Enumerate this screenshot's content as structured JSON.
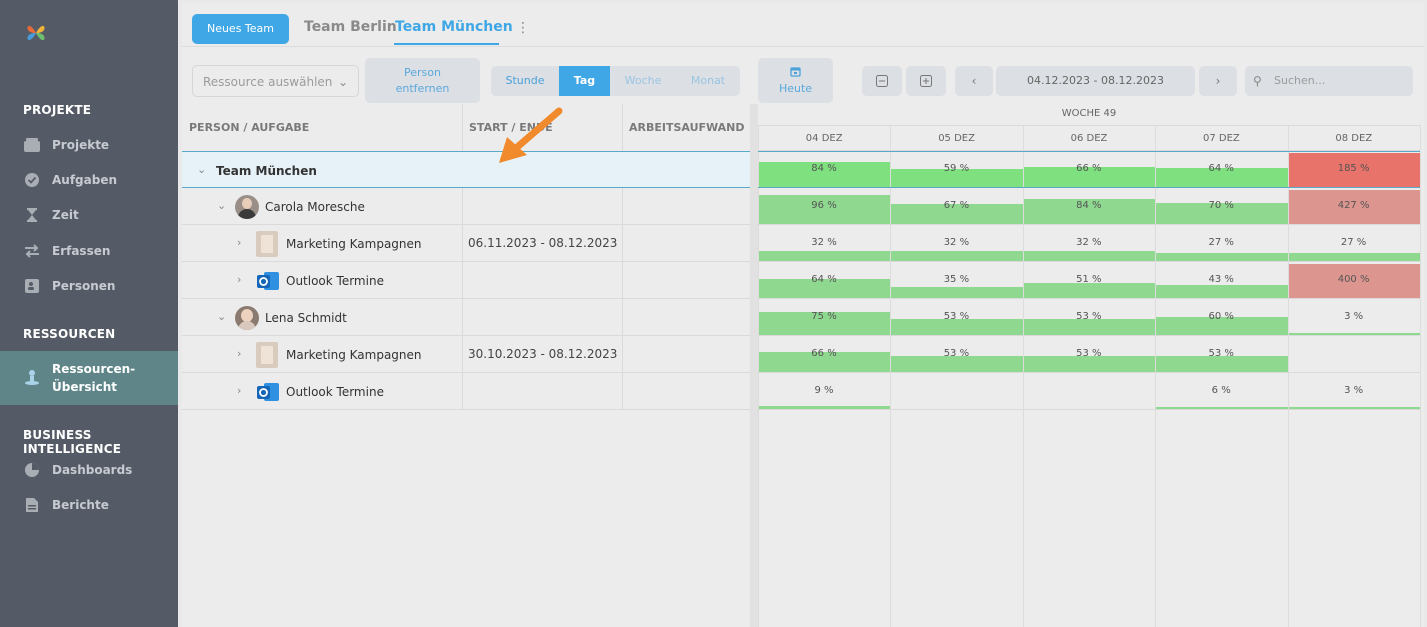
{
  "sidebar": {
    "sections": [
      {
        "title": "PROJEKTE",
        "items": [
          {
            "label": "Projekte",
            "icon": "folder-icon"
          },
          {
            "label": "Aufgaben",
            "icon": "check-circle-icon"
          },
          {
            "label": "Zeit",
            "icon": "hourglass-icon"
          },
          {
            "label": "Erfassen",
            "icon": "swap-icon"
          },
          {
            "label": "Personen",
            "icon": "contact-card-icon"
          }
        ]
      },
      {
        "title": "RESSOURCEN",
        "items": [
          {
            "label_line1": "Ressourcen-",
            "label_line2": "Übersicht",
            "icon": "person-pin-icon",
            "active": true
          }
        ]
      },
      {
        "title": "BUSINESS INTELLIGENCE",
        "items": [
          {
            "label": "Dashboards",
            "icon": "pie-chart-icon"
          },
          {
            "label": "Berichte",
            "icon": "document-icon"
          }
        ]
      }
    ]
  },
  "header": {
    "new_team": "Neues Team",
    "tabs": [
      {
        "label": "Team Berlin",
        "active": false
      },
      {
        "label": "Team München",
        "active": true
      }
    ]
  },
  "toolbar": {
    "resource_placeholder": "Ressource auswählen",
    "remove_person_1": "Person",
    "remove_person_2": "entfernen",
    "scale": [
      "Stunde",
      "Tag",
      "Woche",
      "Monat"
    ],
    "scale_selected": "Tag",
    "today": "Heute",
    "date_range": "04.12.2023 - 08.12.2023",
    "search_placeholder": "Suchen..."
  },
  "grid": {
    "columns": [
      "PERSON / AUFGABE",
      "START / ENDE",
      "ARBEITSAUFWAND"
    ],
    "week_label": "WOCHE 49",
    "days": [
      "04 DEZ",
      "05 DEZ",
      "06 DEZ",
      "07 DEZ",
      "08 DEZ"
    ],
    "rows": [
      {
        "name": "Team München",
        "type": "team",
        "dates": "",
        "load": [
          84,
          59,
          66,
          64,
          185
        ],
        "load_labels": [
          "84 %",
          "59 %",
          "66 %",
          "64 %",
          "185 %"
        ]
      },
      {
        "name": "Carola Moresche",
        "type": "person",
        "dates": "",
        "load": [
          96,
          67,
          84,
          70,
          427
        ],
        "load_labels": [
          "96 %",
          "67 %",
          "84 %",
          "70 %",
          "427 %"
        ]
      },
      {
        "name": "Marketing Kampagnen",
        "type": "project",
        "dates": "06.11.2023 - 08.12.2023",
        "load": [
          32,
          32,
          32,
          27,
          27
        ],
        "load_labels": [
          "32 %",
          "32 %",
          "32 %",
          "27 %",
          "27 %"
        ]
      },
      {
        "name": "Outlook Termine",
        "type": "outlook",
        "dates": "",
        "load": [
          64,
          35,
          51,
          43,
          400
        ],
        "load_labels": [
          "64 %",
          "35 %",
          "51 %",
          "43 %",
          "400 %"
        ]
      },
      {
        "name": "Lena Schmidt",
        "type": "person",
        "dates": "",
        "load": [
          75,
          53,
          53,
          60,
          3
        ],
        "load_labels": [
          "75 %",
          "53 %",
          "53 %",
          "60 %",
          "3 %"
        ]
      },
      {
        "name": "Marketing Kampagnen",
        "type": "project",
        "dates": "30.10.2023 - 08.12.2023",
        "load": [
          66,
          53,
          53,
          53,
          null
        ],
        "load_labels": [
          "66 %",
          "53 %",
          "53 %",
          "53 %",
          ""
        ]
      },
      {
        "name": "Outlook Termine",
        "type": "outlook",
        "dates": "",
        "load": [
          9,
          null,
          null,
          6,
          3
        ],
        "load_labels": [
          "9 %",
          "",
          "",
          "6 %",
          "3 %"
        ]
      }
    ]
  },
  "colors": {
    "accent": "#3fa7e6",
    "ok_strong": "#7ee07e",
    "ok_soft": "#8fd88f",
    "over_strong": "#e8736a",
    "over_soft": "#dc968f"
  }
}
